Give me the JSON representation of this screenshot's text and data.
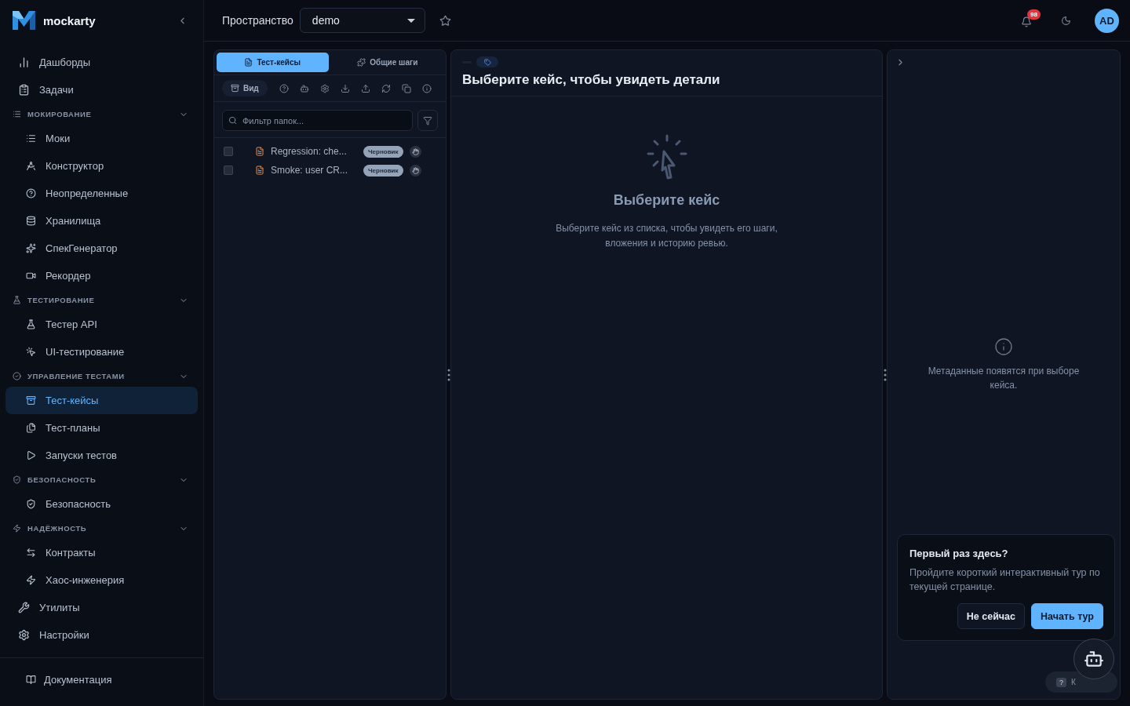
{
  "sidebar": {
    "brand": "mockarty",
    "items": [
      {
        "kind": "link",
        "label": "Дашборды",
        "selected": false
      },
      {
        "kind": "link",
        "label": "Задачи",
        "selected": false
      },
      {
        "kind": "section",
        "label": "МОКИРОВАНИЕ",
        "expanded": true,
        "children": [
          {
            "label": "Моки",
            "selected": false
          },
          {
            "label": "Конструктор",
            "selected": false
          },
          {
            "label": "Неопределенные",
            "selected": false
          },
          {
            "label": "Хранилища",
            "selected": false
          },
          {
            "label": "СпекГенератор",
            "selected": false
          },
          {
            "label": "Рекордер",
            "selected": false
          }
        ]
      },
      {
        "kind": "section",
        "label": "ТЕСТИРОВАНИЕ",
        "expanded": true,
        "children": [
          {
            "label": "Тестер API",
            "selected": false
          },
          {
            "label": "UI-тестирование",
            "selected": false
          }
        ]
      },
      {
        "kind": "section",
        "label": "УПРАВЛЕНИЕ ТЕСТАМИ",
        "expanded": true,
        "children": [
          {
            "label": "Тест-кейсы",
            "selected": true
          },
          {
            "label": "Тест-планы",
            "selected": false
          },
          {
            "label": "Запуски тестов",
            "selected": false
          }
        ]
      },
      {
        "kind": "section",
        "label": "БЕЗОПАСНОСТЬ",
        "expanded": true,
        "children": [
          {
            "label": "Безопасность",
            "selected": false
          }
        ]
      },
      {
        "kind": "section",
        "label": "НАДЁЖНОСТЬ",
        "expanded": true,
        "children": [
          {
            "label": "Контракты",
            "selected": false
          },
          {
            "label": "Хаос-инженерия",
            "selected": false
          }
        ]
      },
      {
        "kind": "link",
        "label": "Утилиты",
        "selected": false
      },
      {
        "kind": "link",
        "label": "Настройки",
        "selected": false
      }
    ],
    "footer_link": "Документация"
  },
  "header": {
    "workspace_label": "Пространство",
    "workspace_value": "demo",
    "notifications": "98",
    "avatar": "AD"
  },
  "left_panel": {
    "tabs": [
      {
        "label": "Тест-кейсы",
        "selected": true
      },
      {
        "label": "Общие шаги",
        "selected": false
      }
    ],
    "view_button": "Вид",
    "filter": {
      "placeholder": "Фильтр папок..."
    },
    "rows": [
      {
        "title": "Regression: che...",
        "status": "Черновик",
        "checked": false
      },
      {
        "title": "Smoke: user CR...",
        "status": "Черновик",
        "checked": false
      }
    ]
  },
  "detail_panel": {
    "title": "Выберите кейс, чтобы увидеть детали",
    "empty_title": "Выберите кейс",
    "empty_text": "Выберите кейс из списка, чтобы увидеть его шаги, вложения и историю ревью."
  },
  "meta_panel": {
    "empty_text": "Метаданные появятся при выборе кейса."
  },
  "tour_popup": {
    "title": "Первый раз здесь?",
    "text": "Пройдите короткий интерактивный тур по текущей странице.",
    "buttons": [
      {
        "label": "Не сейчас",
        "kind": "secondary"
      },
      {
        "label": "Начать тур",
        "kind": "primary"
      }
    ]
  },
  "help_pill": {
    "key": "?",
    "label": "К"
  }
}
